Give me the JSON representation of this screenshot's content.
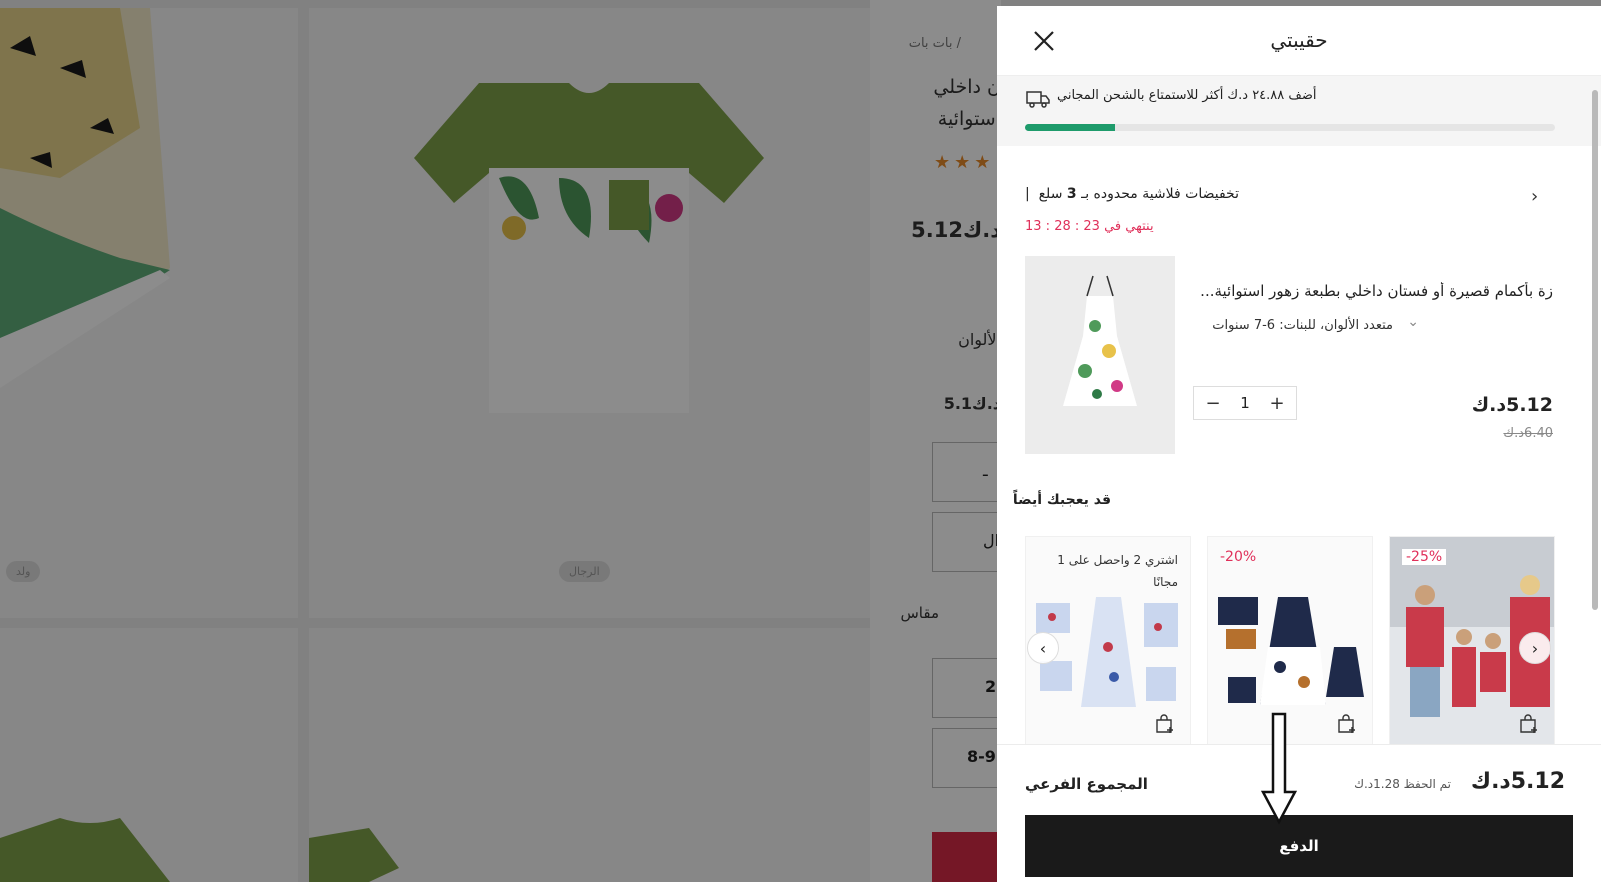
{
  "background": {
    "breadcrumb": "بات بات /",
    "title_line1": "ن داخلي",
    "title_line2": "استوائية",
    "price": "5.12د.ك",
    "colors_label": "الألوان",
    "small_price": "5.1د.ك",
    "size_label": "مقاس",
    "size_opt1": "2",
    "size_opt2": "8-9",
    "box1": "ـ",
    "box2": "ال",
    "tile_label_men": "الرجال",
    "tile_label_kid": "ولد"
  },
  "drawer": {
    "title": "حقيبتي",
    "shipping_text": "أضف ٢٤.٨٨ د.ك أكثر للاستمتاع بالشحن المجاني",
    "shipping_progress": 0.17,
    "flash": {
      "text_prefix": "تخفيضات فلاشية محدوده بـ ",
      "count": "3",
      "text_suffix": " سلع",
      "ends": "ينتهي في 23 : 28 : 13"
    },
    "item": {
      "title": "زة بأكمام قصيرة أو فستان داخلي بطبعة زهور استوائية...",
      "variant": "متعدد الألوان، للبنات: 6-7 سنوات",
      "quantity": "1",
      "price": "5.12د.ك",
      "old_price": "6.40د.ك"
    },
    "also_like": "قد يعجبك أيضاً",
    "cards": [
      {
        "promo": "اشتري 2 واحصل على 1 مجانًا"
      },
      {
        "badge": "-20%"
      },
      {
        "badge": "-25%"
      }
    ],
    "subtotal_label": "المجموع الفرعي",
    "subtotal_value": "5.12د.ك",
    "saved_text": "تم الحفظ 1.28د.ك",
    "checkout_label": "الدفع"
  },
  "colors": {
    "accent_green": "#1e9b6b",
    "flash_red": "#e0305a",
    "checkout_bg": "#1a1a1a"
  }
}
